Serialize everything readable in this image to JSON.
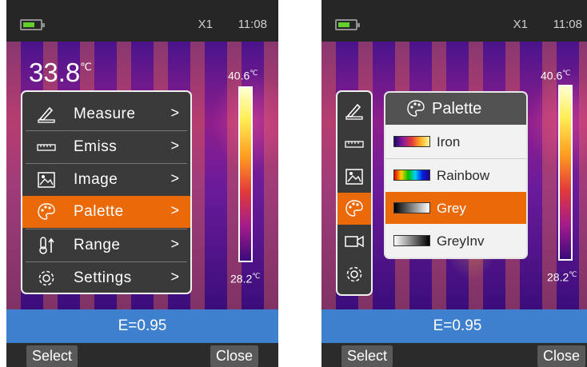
{
  "status": {
    "zoom": "X1",
    "time": "11:08"
  },
  "left_screen": {
    "temperature": "33.8",
    "temperature_unit": "℃",
    "scale_max": "40.6",
    "scale_min": "28.2",
    "scale_unit": "℃",
    "menu": [
      {
        "label": "Measure",
        "icon": "measure-icon",
        "arrow": ">",
        "active": false
      },
      {
        "label": "Emiss",
        "icon": "emissivity-icon",
        "arrow": ">",
        "active": false
      },
      {
        "label": "Image",
        "icon": "image-icon",
        "arrow": ">",
        "active": false
      },
      {
        "label": "Palette",
        "icon": "palette-icon",
        "arrow": ">",
        "active": true
      },
      {
        "label": "Range",
        "icon": "thermometer-icon",
        "arrow": ">",
        "active": false
      },
      {
        "label": "Settings",
        "icon": "gear-icon",
        "arrow": ">",
        "active": false
      }
    ],
    "emissivity": "E=0.95",
    "softkeys": {
      "left": "Select",
      "right": "Close"
    }
  },
  "right_screen": {
    "scale_max": "40.6",
    "scale_min": "28.2",
    "scale_unit": "℃",
    "side_icons": [
      "measure-icon",
      "emissivity-icon",
      "image-icon",
      "palette-icon",
      "video-icon",
      "gear-icon"
    ],
    "side_active_index": 3,
    "palette": {
      "title": "Palette",
      "options": [
        {
          "label": "Iron",
          "active": false
        },
        {
          "label": "Rainbow",
          "active": false
        },
        {
          "label": "Grey",
          "active": true
        },
        {
          "label": "GreyInv",
          "active": false
        }
      ]
    },
    "emissivity": "E=0.95",
    "softkeys": {
      "left": "Select",
      "right": "Close"
    }
  },
  "colors": {
    "accent": "#ea6a0a",
    "emissivity_bar": "#3e7fce",
    "battery": "#62d02c"
  }
}
